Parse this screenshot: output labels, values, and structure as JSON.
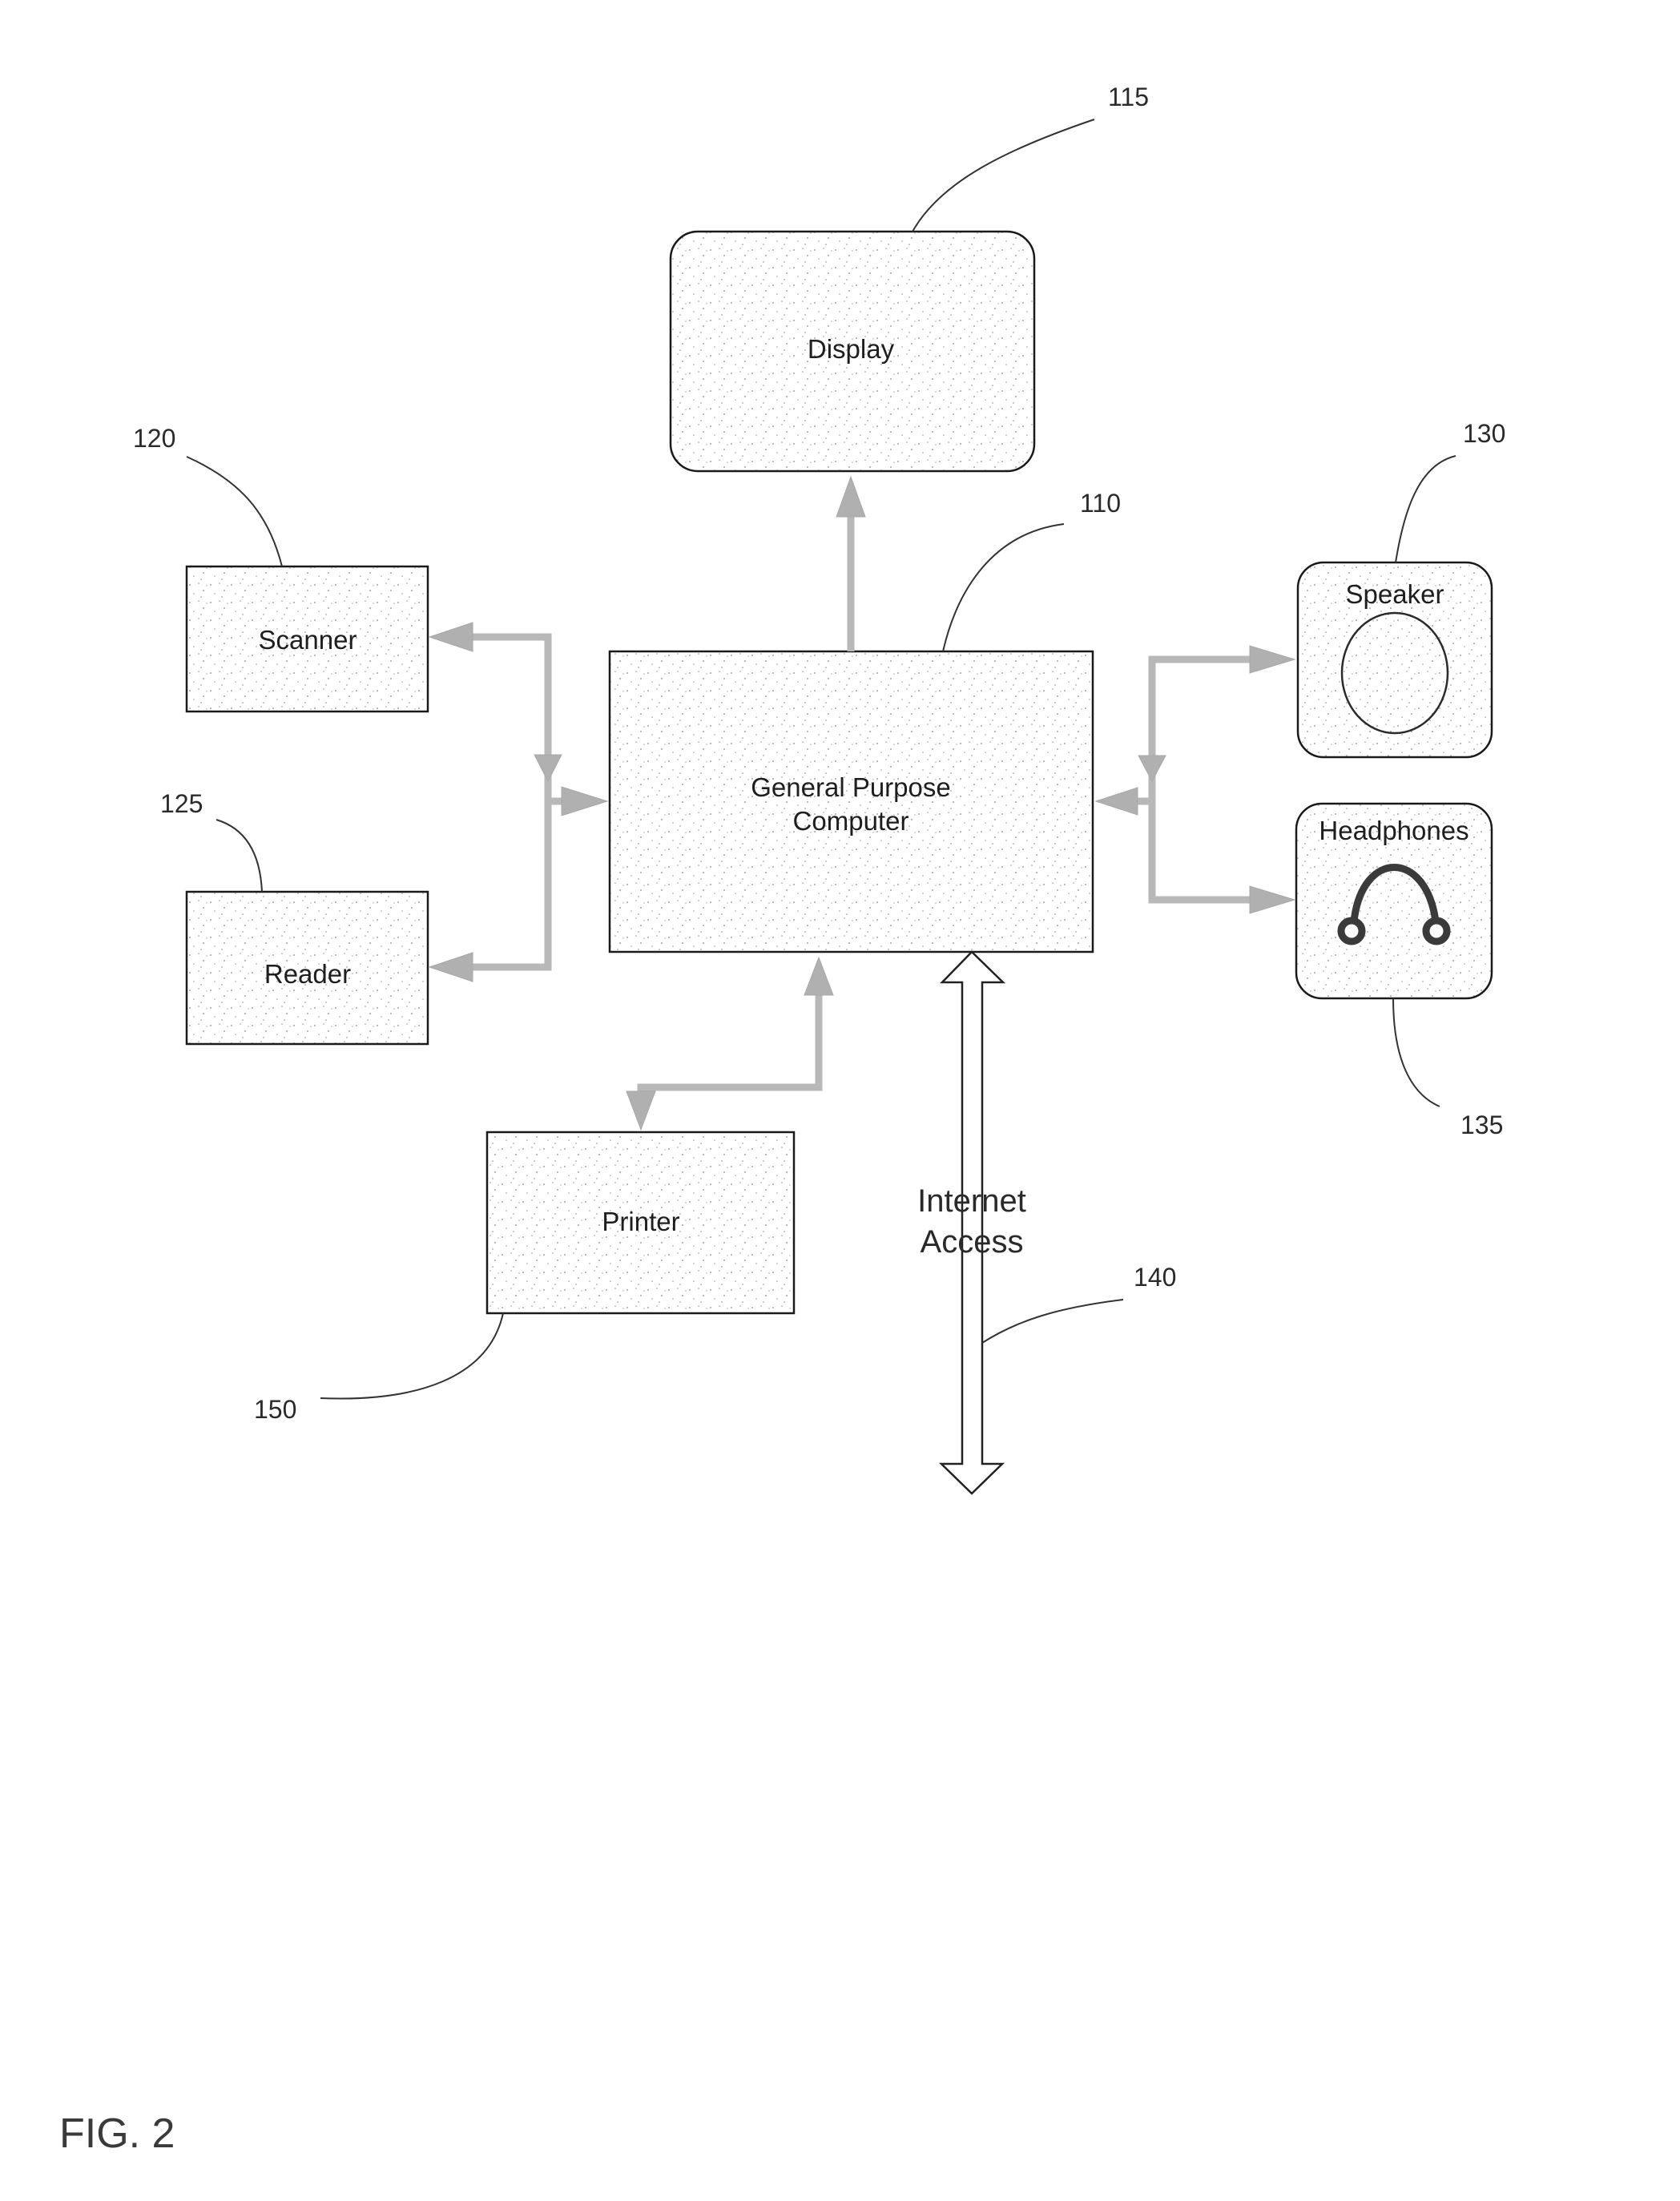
{
  "figure": {
    "caption": "FIG. 2"
  },
  "components": {
    "computer": {
      "label_line1": "General Purpose",
      "label_line2": "Computer",
      "ref": "110"
    },
    "display": {
      "label": "Display",
      "ref": "115"
    },
    "scanner": {
      "label": "Scanner",
      "ref": "120"
    },
    "reader": {
      "label": "Reader",
      "ref": "125"
    },
    "speaker": {
      "label": "Speaker",
      "ref": "130",
      "icon": "speaker-cone-icon"
    },
    "headphones": {
      "label": "Headphones",
      "ref": "135",
      "icon": "headphones-icon"
    },
    "internet": {
      "label_line1": "Internet",
      "label_line2": "Access",
      "ref": "140",
      "icon": "bidirectional-arrow-icon"
    },
    "printer": {
      "label": "Printer",
      "ref": "150"
    }
  },
  "connections": [
    {
      "from": "computer",
      "to": "display",
      "direction": "out"
    },
    {
      "from": "computer",
      "to": "scanner",
      "direction": "bidirectional"
    },
    {
      "from": "computer",
      "to": "reader",
      "direction": "bidirectional"
    },
    {
      "from": "computer",
      "to": "speaker",
      "direction": "bidirectional"
    },
    {
      "from": "computer",
      "to": "headphones",
      "direction": "bidirectional"
    },
    {
      "from": "computer",
      "to": "printer",
      "direction": "bidirectional"
    },
    {
      "from": "computer",
      "to": "internet",
      "direction": "bidirectional"
    }
  ]
}
